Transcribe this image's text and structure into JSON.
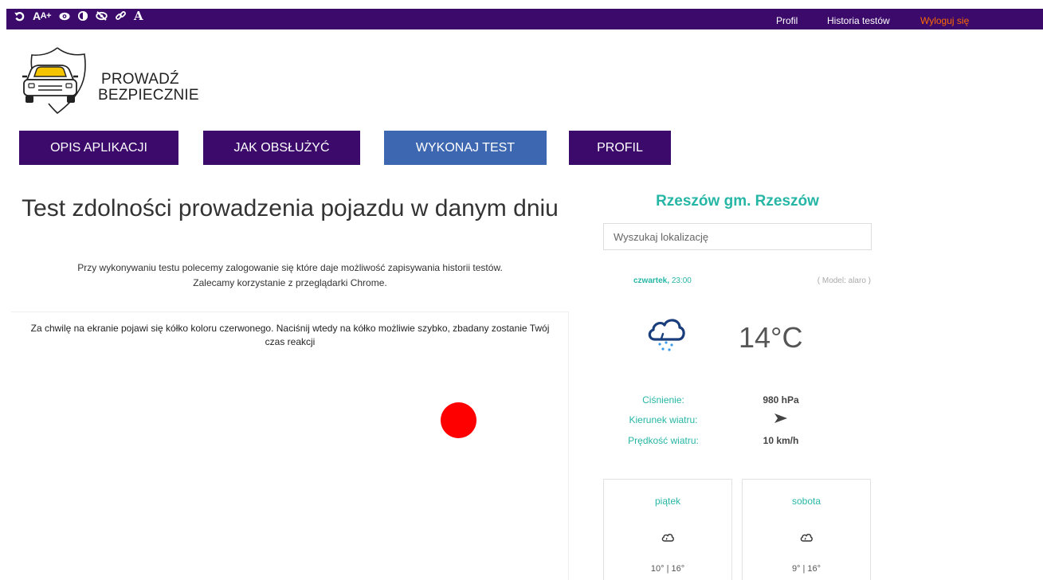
{
  "topbar": {
    "a11y_icons": [
      "reset-icon",
      "font-size-increase-icon",
      "eye-icon",
      "contrast-icon",
      "hide-images-icon",
      "link-icon",
      "font-icon"
    ],
    "links": {
      "profile": "Profil",
      "history": "Historia testów",
      "logout": "Wyloguj się"
    }
  },
  "logo": {
    "line1": "PROWADŹ",
    "line2": "BEZPIECZNIE"
  },
  "nav": {
    "items": [
      {
        "label": "OPIS APLIKACJI"
      },
      {
        "label": "JAK OBSŁUŻYĆ"
      },
      {
        "label": "WYKONAJ TEST"
      },
      {
        "label": "PROFIL"
      }
    ]
  },
  "main": {
    "title": "Test zdolności prowadzenia pojazdu w danym dniu",
    "subtitle1": "Przy wykonywaniu testu polecemy zalogowanie się które daje możliwość zapisywania historii testów.",
    "subtitle2": "Zalecamy korzystanie z przeglądarki Chrome.",
    "instruction": "Za chwilę na ekranie pojawi się kółko koloru czerwonego. Naciśnij wtedy na kółko możliwie szybko, zbadany zostanie Twój czas reakcji",
    "target_color": "#ff0000"
  },
  "weather": {
    "city": "Rzeszów gm. Rzeszów",
    "search_placeholder": "Wyszukaj lokalizację",
    "day": "czwartek,",
    "time": "23:00",
    "model": "( Model: alaro )",
    "condition_icon": "cloud-rain-icon",
    "temp": "14°C",
    "pressure_label": "Ciśnienie:",
    "pressure_value": "980 hPa",
    "wind_dir_label": "Kierunek wiatru:",
    "wind_dir_icon": "arrow-right-icon",
    "wind_speed_label": "Prędkość wiatru:",
    "wind_speed_value": "10 km/h",
    "forecast": [
      {
        "day": "piątek",
        "icon": "cloud-icon",
        "temp": "10° | 16°"
      },
      {
        "day": "sobota",
        "icon": "cloud-icon",
        "temp": "9° | 16°"
      }
    ]
  },
  "colors": {
    "brand": "#3b0a6b",
    "active": "#3d68b1",
    "accent": "#26b6a5",
    "logout": "#ff6a00"
  }
}
